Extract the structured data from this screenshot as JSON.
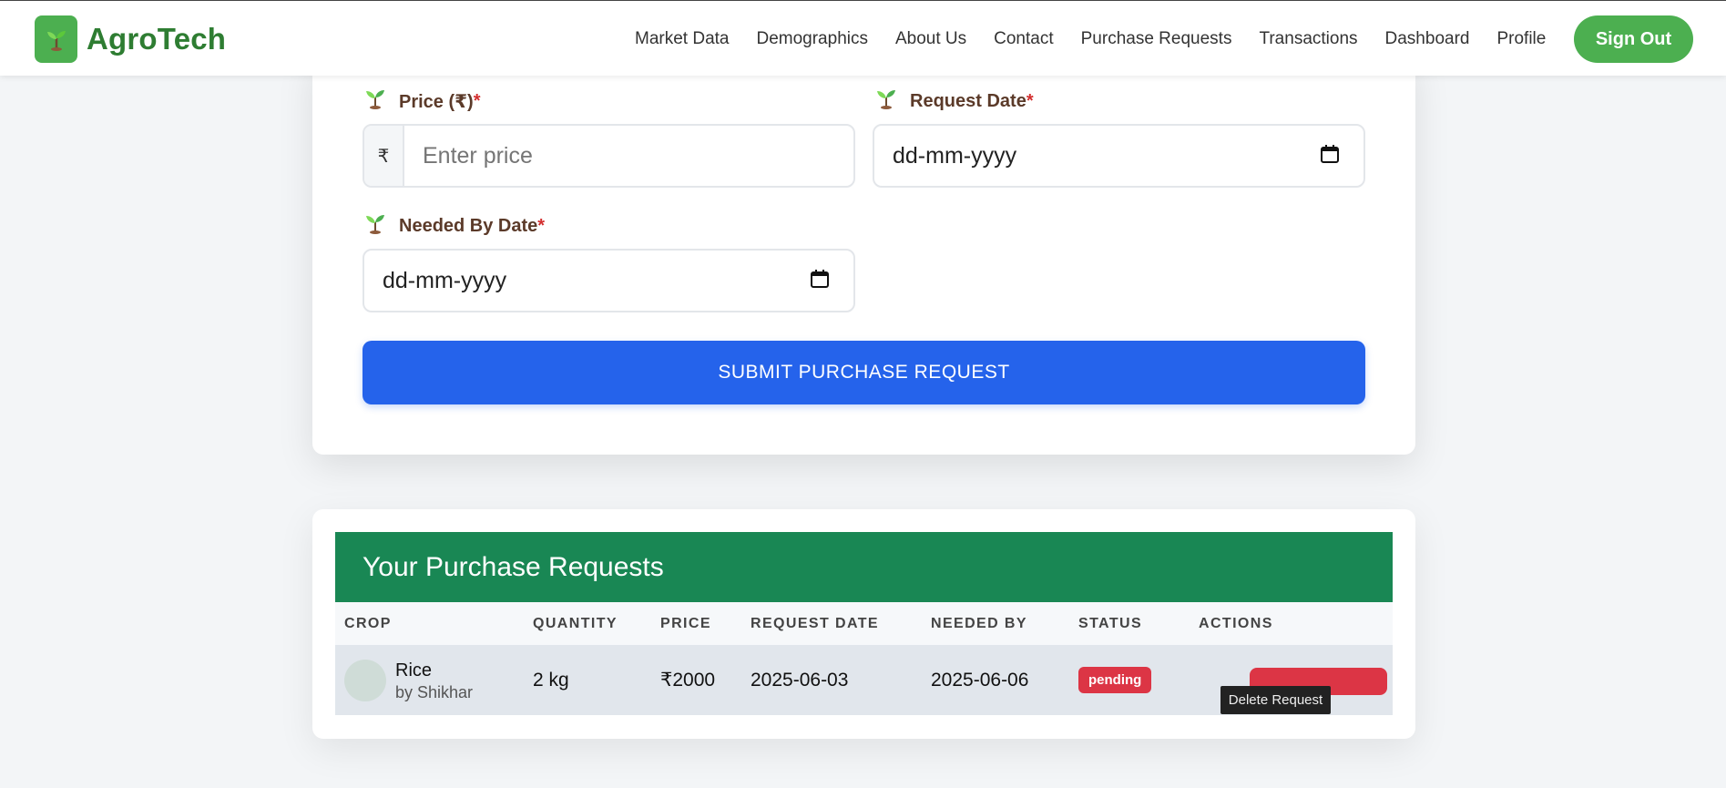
{
  "nav": {
    "brand": "AgroTech",
    "links": [
      "Market Data",
      "Demographics",
      "About Us",
      "Contact",
      "Purchase Requests",
      "Transactions",
      "Dashboard",
      "Profile"
    ],
    "signout": "Sign Out"
  },
  "form": {
    "price_label": "Price (₹)",
    "price_prefix": "₹",
    "price_placeholder": "Enter price",
    "request_date_label": "Request Date",
    "request_date_value": "dd-mm-yyyy",
    "needed_by_label": "Needed By Date",
    "needed_by_value": "dd-mm-yyyy",
    "required_mark": "*",
    "submit_label": "SUBMIT PURCHASE REQUEST"
  },
  "requests": {
    "title": "Your Purchase Requests",
    "columns": [
      "CROP",
      "QUANTITY",
      "PRICE",
      "REQUEST DATE",
      "NEEDED BY",
      "STATUS",
      "ACTIONS"
    ],
    "rows": [
      {
        "crop": "Rice",
        "seller": "by Shikhar",
        "quantity": "2 kg",
        "price": "₹2000",
        "request_date": "2025-06-03",
        "needed_by": "2025-06-06",
        "status": "pending"
      }
    ],
    "tooltip": "Delete Request"
  },
  "colors": {
    "brand_green": "#4caf50",
    "header_green": "#198754",
    "submit_blue": "#2563eb",
    "danger_red": "#dc3545",
    "label_brown": "#5b3a29"
  },
  "icons": [
    "sprout-icon",
    "calendar-icon"
  ]
}
